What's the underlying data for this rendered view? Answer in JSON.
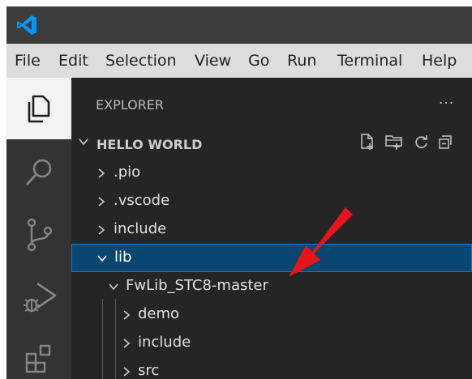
{
  "menu": [
    "File",
    "Edit",
    "Selection",
    "View",
    "Go",
    "Run",
    "Terminal",
    "Help"
  ],
  "activity_bar": {
    "items": [
      {
        "name": "explorer-icon",
        "active": true
      },
      {
        "name": "search-icon"
      },
      {
        "name": "source-control-icon"
      },
      {
        "name": "run-debug-icon"
      },
      {
        "name": "extensions-icon"
      }
    ]
  },
  "sidebar": {
    "title": "EXPLORER",
    "more": "···",
    "section": "HELLO WORLD",
    "header_actions": [
      "new-file-icon",
      "new-folder-icon",
      "refresh-icon",
      "collapse-all-icon"
    ],
    "tree": [
      {
        "label": ".pio",
        "expanded": false
      },
      {
        "label": ".vscode",
        "expanded": false
      },
      {
        "label": "include",
        "expanded": false
      },
      {
        "label": "lib",
        "expanded": true,
        "selected": true
      },
      {
        "label": "FwLib_STC8-master",
        "expanded": true
      },
      {
        "label": "demo",
        "expanded": false
      },
      {
        "label": "include",
        "expanded": false
      },
      {
        "label": "src",
        "expanded": false
      }
    ]
  },
  "colors": {
    "titlebar": "#3c3c3c",
    "menubar": "#dddddd",
    "activity_bar": "#333333",
    "sidebar": "#252526",
    "selection": "#094771",
    "annotation_arrow": "#e8141b",
    "vscode_blue": "#0098ff"
  }
}
